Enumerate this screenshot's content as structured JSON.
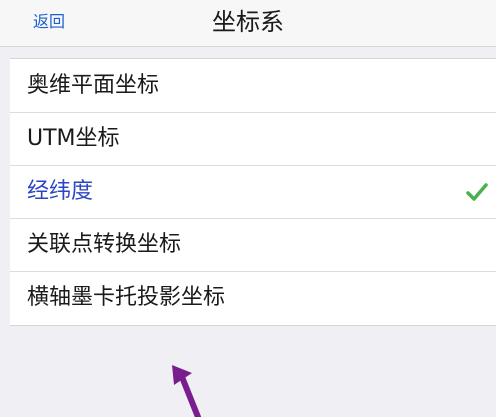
{
  "navbar": {
    "back_label": "返回",
    "title": "坐标系"
  },
  "list": {
    "items": [
      {
        "label": "奥维平面坐标",
        "selected": false
      },
      {
        "label": "UTM坐标",
        "selected": false
      },
      {
        "label": "经纬度",
        "selected": true
      },
      {
        "label": "关联点转换坐标",
        "selected": false
      },
      {
        "label": "横轴墨卡托投影坐标",
        "selected": false
      }
    ]
  },
  "icons": {
    "checkmark": "checkmark-icon",
    "annotation": "arrow-up-icon"
  },
  "colors": {
    "accent": "#1f5fd1",
    "selected_text": "#2b45c6",
    "checkmark": "#4caf50",
    "annotation_arrow": "#7a1d8f"
  }
}
